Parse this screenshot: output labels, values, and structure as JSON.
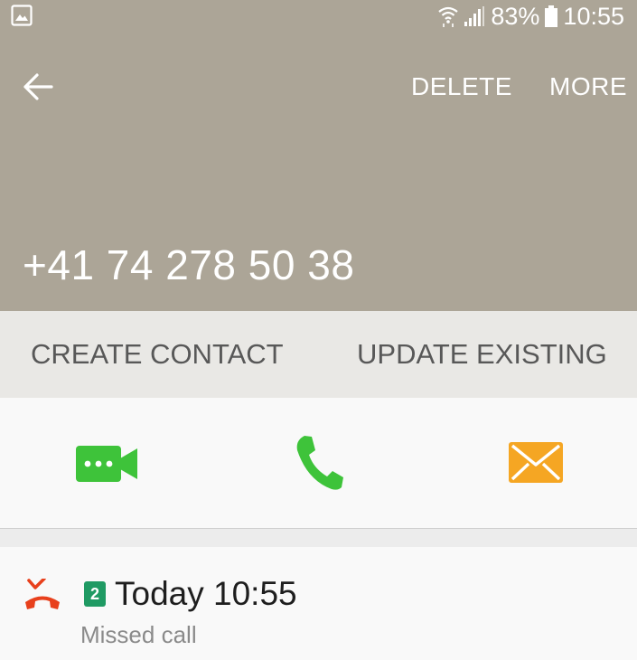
{
  "status_bar": {
    "battery": "83%",
    "time": "10:55",
    "icons": [
      "gallery-icon",
      "wifi-icon",
      "signal-icon",
      "battery-icon"
    ]
  },
  "header": {
    "actions": {
      "delete_label": "DELETE",
      "more_label": "MORE"
    },
    "phone_number": "+41 74 278 50 38",
    "background_color": "#aca597"
  },
  "contact_actions": {
    "create_label": "CREATE CONTACT",
    "update_label": "UPDATE EXISTING"
  },
  "communication": {
    "icons": [
      "video-call-icon",
      "phone-icon",
      "message-icon"
    ],
    "colors": {
      "video": "#3ec33a",
      "call": "#3ec33a",
      "message": "#f5a623"
    }
  },
  "call_log": [
    {
      "sim": "2",
      "time": "Today 10:55",
      "type": "Missed call",
      "icon": "missed-call-icon",
      "icon_color": "#e8401c"
    }
  ]
}
